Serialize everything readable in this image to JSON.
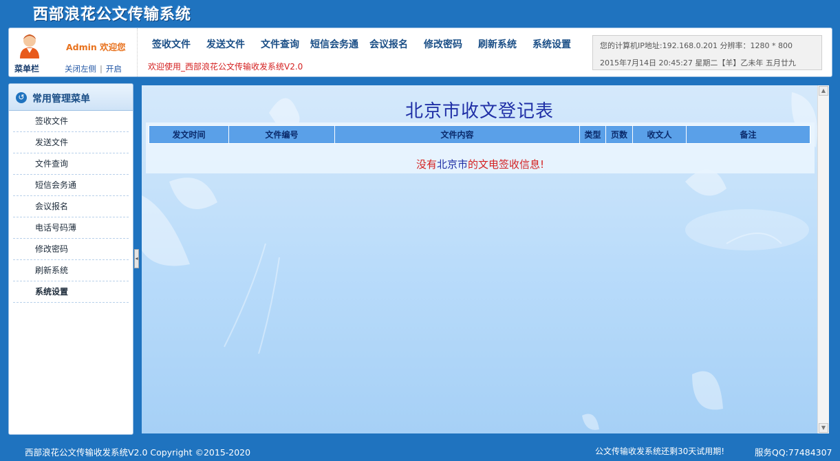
{
  "app": {
    "title": "西部浪花公文传输系统"
  },
  "header": {
    "admin_welcome": "Admin 欢迎您",
    "menu_bar_label": "菜单栏",
    "toggle": {
      "close_left": "关闭左侧",
      "open": "开启"
    },
    "nav": [
      "签收文件",
      "发送文件",
      "文件查询",
      "短信会务通",
      "会议报名",
      "修改密码",
      "刷新系统",
      "系统设置"
    ],
    "marquee": "欢迎使用_西部浪花公文传输收发系统V2.0",
    "sysinfo": {
      "line1": "您的计算机IP地址:192.168.0.201   分辨率：1280 * 800",
      "line2": "2015年7月14日 20:45:27 星期二【羊】乙未年  五月廿九"
    }
  },
  "sidebar": {
    "title": "常用管理菜单",
    "items": [
      "签收文件",
      "发送文件",
      "文件查询",
      "短信会务通",
      "会议报名",
      "电话号码薄",
      "修改密码",
      "刷新系统",
      "系统设置"
    ]
  },
  "main": {
    "heading": "北京市收文登记表",
    "columns": [
      "发文时间",
      "文件编号",
      "文件内容",
      "类型",
      "页数",
      "收文人",
      "备注"
    ],
    "empty": {
      "prefix": "没有",
      "city": "北京市",
      "suffix": "的文电签收信息!"
    }
  },
  "footer": {
    "left": "西部浪花公文传输收发系统V2.0  Copyright ©2015-2020",
    "trial": "公文传输收发系统还剩30天试用期!",
    "qq": "服务QQ:77484307"
  }
}
